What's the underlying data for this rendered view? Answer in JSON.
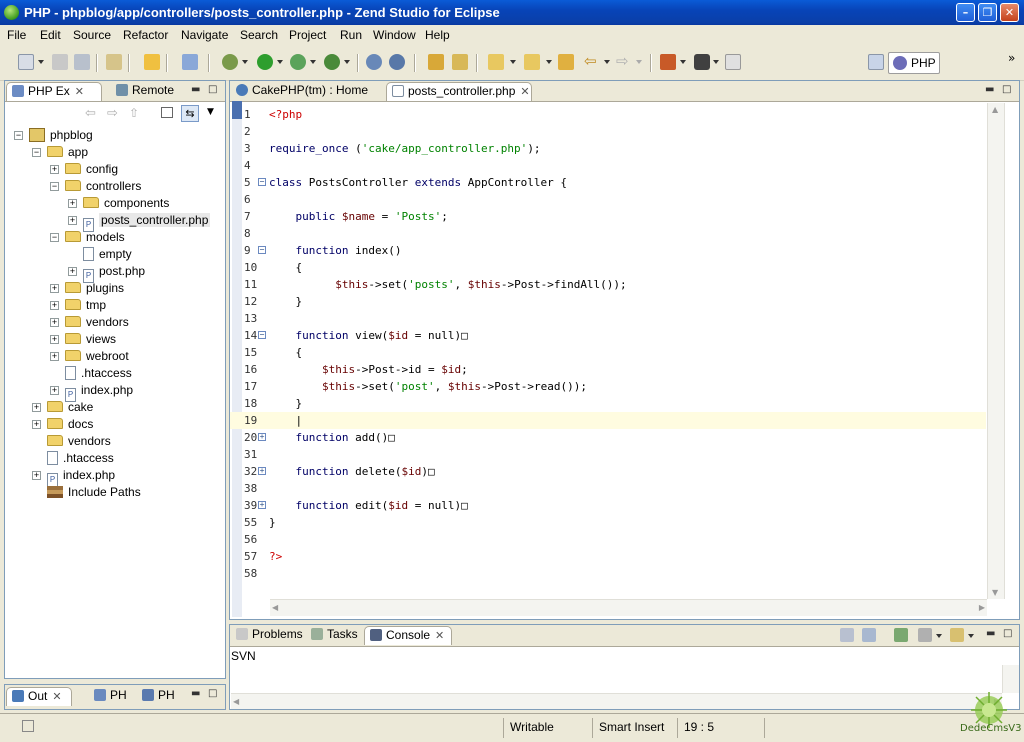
{
  "window": {
    "title": "PHP - phpblog/app/controllers/posts_controller.php - Zend Studio for Eclipse"
  },
  "menu": [
    "File",
    "Edit",
    "Source",
    "Refactor",
    "Navigate",
    "Search",
    "Project",
    "Run",
    "Window",
    "Help"
  ],
  "perspective": {
    "label": "PHP"
  },
  "left_panel": {
    "tabs": [
      {
        "label": "PHP Ex",
        "active": true
      },
      {
        "label": "Remote",
        "active": false
      }
    ],
    "tree": [
      {
        "label": "phpblog",
        "type": "project",
        "depth": 0,
        "expander": "-"
      },
      {
        "label": "app",
        "type": "folder",
        "depth": 1,
        "expander": "-"
      },
      {
        "label": "config",
        "type": "folder",
        "depth": 2,
        "expander": "+"
      },
      {
        "label": "controllers",
        "type": "folder",
        "depth": 2,
        "expander": "-"
      },
      {
        "label": "components",
        "type": "folder",
        "depth": 3,
        "expander": "+"
      },
      {
        "label": "posts_controller.php",
        "type": "file",
        "depth": 3,
        "expander": "+",
        "selected": true
      },
      {
        "label": "models",
        "type": "folder",
        "depth": 2,
        "expander": "-"
      },
      {
        "label": "empty",
        "type": "plain",
        "depth": 3,
        "expander": ""
      },
      {
        "label": "post.php",
        "type": "file",
        "depth": 3,
        "expander": "+"
      },
      {
        "label": "plugins",
        "type": "folder",
        "depth": 2,
        "expander": "+"
      },
      {
        "label": "tmp",
        "type": "folder",
        "depth": 2,
        "expander": "+"
      },
      {
        "label": "vendors",
        "type": "folder",
        "depth": 2,
        "expander": "+"
      },
      {
        "label": "views",
        "type": "folder",
        "depth": 2,
        "expander": "+"
      },
      {
        "label": "webroot",
        "type": "folder",
        "depth": 2,
        "expander": "+"
      },
      {
        "label": ".htaccess",
        "type": "plain",
        "depth": 2,
        "expander": ""
      },
      {
        "label": "index.php",
        "type": "file",
        "depth": 2,
        "expander": "+"
      },
      {
        "label": "cake",
        "type": "folder",
        "depth": 1,
        "expander": "+"
      },
      {
        "label": "docs",
        "type": "folder",
        "depth": 1,
        "expander": "+"
      },
      {
        "label": "vendors",
        "type": "folder",
        "depth": 1,
        "expander": ""
      },
      {
        "label": ".htaccess",
        "type": "plain",
        "depth": 1,
        "expander": ""
      },
      {
        "label": "index.php",
        "type": "file",
        "depth": 1,
        "expander": "+"
      },
      {
        "label": "Include Paths",
        "type": "libs",
        "depth": 1,
        "expander": ""
      }
    ]
  },
  "outline_panel": {
    "tabs": [
      {
        "label": "Out",
        "active": true
      },
      {
        "label": "PH",
        "active": false
      },
      {
        "label": "PH",
        "active": false
      }
    ]
  },
  "editor": {
    "tabs": [
      {
        "label": "CakePHP(tm) : Home",
        "active": false
      },
      {
        "label": "posts_controller.php",
        "active": true
      }
    ],
    "lines": [
      {
        "n": "1",
        "fold": "",
        "html": "<span class=\"tag\">&lt;?php</span>"
      },
      {
        "n": "2",
        "fold": "",
        "html": ""
      },
      {
        "n": "3",
        "fold": "",
        "html": "<span class=\"kw\">require_once</span> (<span class=\"str\">'cake/app_controller.php'</span>);"
      },
      {
        "n": "4",
        "fold": "",
        "html": ""
      },
      {
        "n": "5",
        "fold": "-",
        "html": "<span class=\"kw\">class</span> PostsController <span class=\"kw\">extends</span> AppController {"
      },
      {
        "n": "6",
        "fold": "",
        "html": ""
      },
      {
        "n": "7",
        "fold": "",
        "html": "    <span class=\"kw\">public</span> <span class=\"var\">$name</span> = <span class=\"str\">'Posts'</span>;"
      },
      {
        "n": "8",
        "fold": "",
        "html": ""
      },
      {
        "n": "9",
        "fold": "-",
        "html": "    <span class=\"kw\">function</span> index()"
      },
      {
        "n": "10",
        "fold": "",
        "html": "    {"
      },
      {
        "n": "11",
        "fold": "",
        "html": "          <span class=\"var\">$this</span>-&gt;set(<span class=\"str\">'posts'</span>, <span class=\"var\">$this</span>-&gt;Post-&gt;findAll());"
      },
      {
        "n": "12",
        "fold": "",
        "html": "    }"
      },
      {
        "n": "13",
        "fold": "",
        "html": ""
      },
      {
        "n": "14",
        "fold": "-",
        "html": "    <span class=\"kw\">function</span> view(<span class=\"var\">$id</span> = null)&#9633;"
      },
      {
        "n": "15",
        "fold": "",
        "html": "    {"
      },
      {
        "n": "16",
        "fold": "",
        "html": "        <span class=\"var\">$this</span>-&gt;Post-&gt;id = <span class=\"var\">$id</span>;"
      },
      {
        "n": "17",
        "fold": "",
        "html": "        <span class=\"var\">$this</span>-&gt;set(<span class=\"str\">'post'</span>, <span class=\"var\">$this</span>-&gt;Post-&gt;read());"
      },
      {
        "n": "18",
        "fold": "",
        "html": "    }"
      },
      {
        "n": "19",
        "fold": "",
        "html": "    |",
        "current": true
      },
      {
        "n": "20",
        "fold": "+",
        "html": "    <span class=\"kw\">function</span> add()&#9633;"
      },
      {
        "n": "31",
        "fold": "",
        "html": ""
      },
      {
        "n": "32",
        "fold": "+",
        "html": "    <span class=\"kw\">function</span> delete(<span class=\"var\">$id</span>)&#9633;"
      },
      {
        "n": "38",
        "fold": "",
        "html": ""
      },
      {
        "n": "39",
        "fold": "+",
        "html": "    <span class=\"kw\">function</span> edit(<span class=\"var\">$id</span> = null)&#9633;"
      },
      {
        "n": "55",
        "fold": "",
        "html": "}"
      },
      {
        "n": "56",
        "fold": "",
        "html": ""
      },
      {
        "n": "57",
        "fold": "",
        "html": "<span class=\"tag\">?&gt;</span>"
      },
      {
        "n": "58",
        "fold": "",
        "html": ""
      }
    ]
  },
  "bottom_panel": {
    "tabs": [
      {
        "label": "Problems",
        "active": false
      },
      {
        "label": "Tasks",
        "active": false
      },
      {
        "label": "Console",
        "active": true
      }
    ],
    "console_label": "SVN"
  },
  "status": {
    "writable": "Writable",
    "insert_mode": "Smart Insert",
    "position": "19 : 5"
  },
  "watermark_text": "DedeCmsV3"
}
